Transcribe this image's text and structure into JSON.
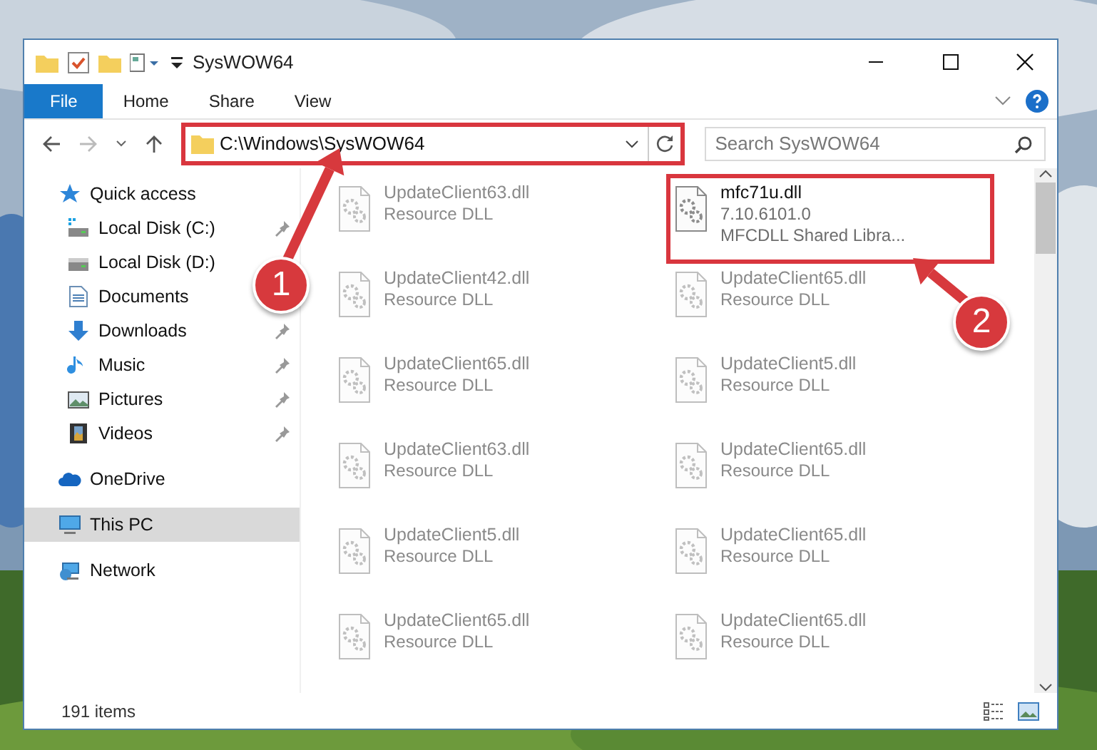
{
  "window": {
    "title": "SysWOW64"
  },
  "ribbon": {
    "tabs": [
      {
        "label": "File",
        "selected": true
      },
      {
        "label": "Home",
        "selected": false
      },
      {
        "label": "Share",
        "selected": false
      },
      {
        "label": "View",
        "selected": false
      }
    ]
  },
  "address_bar": {
    "path": "C:\\Windows\\SysWOW64",
    "highlighted": true
  },
  "search": {
    "placeholder": "Search SysWOW64"
  },
  "sidebar": {
    "items": [
      {
        "label": "Quick access",
        "kind": "star",
        "pinned": false,
        "selected": false,
        "children": [
          {
            "label": "Local Disk (C:)",
            "kind": "disk-c",
            "pinned": true,
            "selected": false
          },
          {
            "label": "Local Disk (D:)",
            "kind": "disk",
            "pinned": false,
            "selected": false
          },
          {
            "label": "Documents",
            "kind": "document",
            "pinned": false,
            "selected": false
          },
          {
            "label": "Downloads",
            "kind": "download",
            "pinned": true,
            "selected": false
          },
          {
            "label": "Music",
            "kind": "music",
            "pinned": true,
            "selected": false
          },
          {
            "label": "Pictures",
            "kind": "pictures",
            "pinned": true,
            "selected": false
          },
          {
            "label": "Videos",
            "kind": "videos",
            "pinned": true,
            "selected": false
          }
        ]
      },
      {
        "label": "OneDrive",
        "kind": "cloud",
        "pinned": false,
        "selected": false
      },
      {
        "label": "This PC",
        "kind": "pc",
        "pinned": false,
        "selected": true
      },
      {
        "label": "Network",
        "kind": "network",
        "pinned": false,
        "selected": false
      }
    ]
  },
  "files": [
    {
      "name": "UpdateClient63.dll",
      "lines": [
        "Resource DLL"
      ],
      "blurred": true,
      "highlighted": false
    },
    {
      "name": "mfc71u.dll",
      "lines": [
        "7.10.6101.0",
        "MFCDLL Shared Libra..."
      ],
      "blurred": false,
      "highlighted": true
    },
    {
      "name": "UpdateClient42.dll",
      "lines": [
        "Resource DLL"
      ],
      "blurred": true,
      "highlighted": false
    },
    {
      "name": "UpdateClient65.dll",
      "lines": [
        "Resource DLL"
      ],
      "blurred": true,
      "highlighted": false
    },
    {
      "name": "UpdateClient65.dll",
      "lines": [
        "Resource DLL"
      ],
      "blurred": true,
      "highlighted": false
    },
    {
      "name": "UpdateClient5.dll",
      "lines": [
        "Resource DLL"
      ],
      "blurred": true,
      "highlighted": false
    },
    {
      "name": "UpdateClient63.dll",
      "lines": [
        "Resource DLL"
      ],
      "blurred": true,
      "highlighted": false
    },
    {
      "name": "UpdateClient65.dll",
      "lines": [
        "Resource DLL"
      ],
      "blurred": true,
      "highlighted": false
    },
    {
      "name": "UpdateClient5.dll",
      "lines": [
        "Resource DLL"
      ],
      "blurred": true,
      "highlighted": false
    },
    {
      "name": "UpdateClient65.dll",
      "lines": [
        "Resource DLL"
      ],
      "blurred": true,
      "highlighted": false
    },
    {
      "name": "UpdateClient65.dll",
      "lines": [
        "Resource DLL"
      ],
      "blurred": true,
      "highlighted": false
    },
    {
      "name": "UpdateClient65.dll",
      "lines": [
        "Resource DLL"
      ],
      "blurred": true,
      "highlighted": false
    }
  ],
  "status_bar": {
    "item_count": "191 items"
  },
  "annotations": [
    {
      "number": "1"
    },
    {
      "number": "2"
    }
  ]
}
